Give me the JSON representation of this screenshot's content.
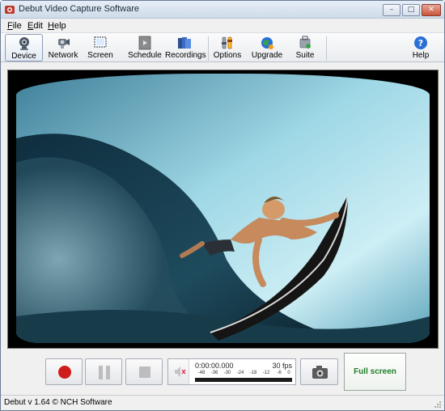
{
  "window": {
    "title": "Debut Video Capture Software",
    "minimize_glyph": "–",
    "maximize_glyph": "□",
    "close_glyph": "✕"
  },
  "menu": {
    "items": [
      {
        "label": "File",
        "accel": "F",
        "rest": "ile"
      },
      {
        "label": "Edit",
        "accel": "E",
        "rest": "dit"
      },
      {
        "label": "Help",
        "accel": "H",
        "rest": "elp"
      }
    ]
  },
  "toolbar": {
    "items": [
      {
        "label": "Device",
        "icon": "webcam-icon",
        "active": true
      },
      {
        "label": "Network",
        "icon": "network-camera-icon"
      },
      {
        "label": "Screen",
        "icon": "screen-icon"
      },
      {
        "label": "Schedule",
        "icon": "schedule-icon"
      },
      {
        "label": "Recordings",
        "icon": "recordings-icon"
      },
      {
        "label": "Options",
        "icon": "options-icon"
      },
      {
        "label": "Upgrade",
        "icon": "upgrade-globe-icon"
      },
      {
        "label": "Suite",
        "icon": "suite-icon"
      },
      {
        "label": "Help",
        "icon": "help-icon"
      }
    ]
  },
  "preview": {
    "content": "surfer-underwater-wave-video-frame"
  },
  "controls": {
    "timecode": "0:00:00.000",
    "fps": "30 fps",
    "scale_labels": [
      "-48",
      "-36",
      "-30",
      "-24",
      "-18",
      "-12",
      "-6",
      "0"
    ],
    "fullscreen_label": "Full screen"
  },
  "status": {
    "text": "Debut v 1.64 © NCH Software"
  },
  "colors": {
    "record": "#d01b1b",
    "fullscreen_text": "#1f7d26",
    "accent": "#2a6fd6"
  }
}
